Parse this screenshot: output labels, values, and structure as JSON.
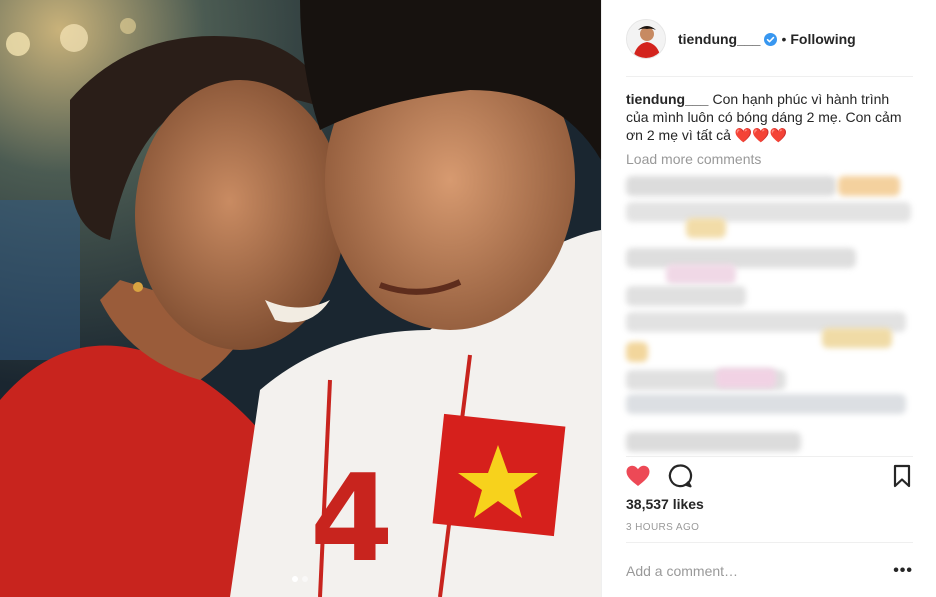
{
  "post": {
    "photo_alt": "mother-son-embrace-photo",
    "carousel": {
      "count": 2,
      "active_index": 0
    }
  },
  "header": {
    "username": "tiendung___",
    "verified": true,
    "separator": "•",
    "follow_state": "Following"
  },
  "caption": {
    "username": "tiendung___",
    "text": "Con hạnh phúc vì hành trình của mình luôn có bóng dáng 2 mẹ. Con cảm ơn 2 mẹ vì tất cả ❤️❤️❤️"
  },
  "comments": {
    "load_more_label": "Load more comments"
  },
  "actions": {
    "like_icon": "heart-filled-icon",
    "comment_icon": "comment-icon",
    "save_icon": "bookmark-icon",
    "like_color": "#ed4956"
  },
  "stats": {
    "likes": "38,537 likes",
    "timestamp": "3 HOURS AGO"
  },
  "comment_box": {
    "placeholder": "Add a comment…",
    "more_label": "•••"
  }
}
